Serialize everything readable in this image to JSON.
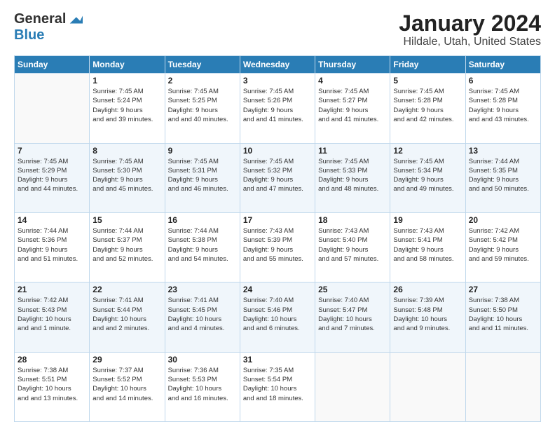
{
  "logo": {
    "general": "General",
    "blue": "Blue"
  },
  "title": "January 2024",
  "location": "Hildale, Utah, United States",
  "days_of_week": [
    "Sunday",
    "Monday",
    "Tuesday",
    "Wednesday",
    "Thursday",
    "Friday",
    "Saturday"
  ],
  "weeks": [
    [
      {
        "day": "",
        "sunrise": "",
        "sunset": "",
        "daylight": ""
      },
      {
        "day": "1",
        "sunrise": "Sunrise: 7:45 AM",
        "sunset": "Sunset: 5:24 PM",
        "daylight": "Daylight: 9 hours and 39 minutes."
      },
      {
        "day": "2",
        "sunrise": "Sunrise: 7:45 AM",
        "sunset": "Sunset: 5:25 PM",
        "daylight": "Daylight: 9 hours and 40 minutes."
      },
      {
        "day": "3",
        "sunrise": "Sunrise: 7:45 AM",
        "sunset": "Sunset: 5:26 PM",
        "daylight": "Daylight: 9 hours and 41 minutes."
      },
      {
        "day": "4",
        "sunrise": "Sunrise: 7:45 AM",
        "sunset": "Sunset: 5:27 PM",
        "daylight": "Daylight: 9 hours and 41 minutes."
      },
      {
        "day": "5",
        "sunrise": "Sunrise: 7:45 AM",
        "sunset": "Sunset: 5:28 PM",
        "daylight": "Daylight: 9 hours and 42 minutes."
      },
      {
        "day": "6",
        "sunrise": "Sunrise: 7:45 AM",
        "sunset": "Sunset: 5:28 PM",
        "daylight": "Daylight: 9 hours and 43 minutes."
      }
    ],
    [
      {
        "day": "7",
        "sunrise": "Sunrise: 7:45 AM",
        "sunset": "Sunset: 5:29 PM",
        "daylight": "Daylight: 9 hours and 44 minutes."
      },
      {
        "day": "8",
        "sunrise": "Sunrise: 7:45 AM",
        "sunset": "Sunset: 5:30 PM",
        "daylight": "Daylight: 9 hours and 45 minutes."
      },
      {
        "day": "9",
        "sunrise": "Sunrise: 7:45 AM",
        "sunset": "Sunset: 5:31 PM",
        "daylight": "Daylight: 9 hours and 46 minutes."
      },
      {
        "day": "10",
        "sunrise": "Sunrise: 7:45 AM",
        "sunset": "Sunset: 5:32 PM",
        "daylight": "Daylight: 9 hours and 47 minutes."
      },
      {
        "day": "11",
        "sunrise": "Sunrise: 7:45 AM",
        "sunset": "Sunset: 5:33 PM",
        "daylight": "Daylight: 9 hours and 48 minutes."
      },
      {
        "day": "12",
        "sunrise": "Sunrise: 7:45 AM",
        "sunset": "Sunset: 5:34 PM",
        "daylight": "Daylight: 9 hours and 49 minutes."
      },
      {
        "day": "13",
        "sunrise": "Sunrise: 7:44 AM",
        "sunset": "Sunset: 5:35 PM",
        "daylight": "Daylight: 9 hours and 50 minutes."
      }
    ],
    [
      {
        "day": "14",
        "sunrise": "Sunrise: 7:44 AM",
        "sunset": "Sunset: 5:36 PM",
        "daylight": "Daylight: 9 hours and 51 minutes."
      },
      {
        "day": "15",
        "sunrise": "Sunrise: 7:44 AM",
        "sunset": "Sunset: 5:37 PM",
        "daylight": "Daylight: 9 hours and 52 minutes."
      },
      {
        "day": "16",
        "sunrise": "Sunrise: 7:44 AM",
        "sunset": "Sunset: 5:38 PM",
        "daylight": "Daylight: 9 hours and 54 minutes."
      },
      {
        "day": "17",
        "sunrise": "Sunrise: 7:43 AM",
        "sunset": "Sunset: 5:39 PM",
        "daylight": "Daylight: 9 hours and 55 minutes."
      },
      {
        "day": "18",
        "sunrise": "Sunrise: 7:43 AM",
        "sunset": "Sunset: 5:40 PM",
        "daylight": "Daylight: 9 hours and 57 minutes."
      },
      {
        "day": "19",
        "sunrise": "Sunrise: 7:43 AM",
        "sunset": "Sunset: 5:41 PM",
        "daylight": "Daylight: 9 hours and 58 minutes."
      },
      {
        "day": "20",
        "sunrise": "Sunrise: 7:42 AM",
        "sunset": "Sunset: 5:42 PM",
        "daylight": "Daylight: 9 hours and 59 minutes."
      }
    ],
    [
      {
        "day": "21",
        "sunrise": "Sunrise: 7:42 AM",
        "sunset": "Sunset: 5:43 PM",
        "daylight": "Daylight: 10 hours and 1 minute."
      },
      {
        "day": "22",
        "sunrise": "Sunrise: 7:41 AM",
        "sunset": "Sunset: 5:44 PM",
        "daylight": "Daylight: 10 hours and 2 minutes."
      },
      {
        "day": "23",
        "sunrise": "Sunrise: 7:41 AM",
        "sunset": "Sunset: 5:45 PM",
        "daylight": "Daylight: 10 hours and 4 minutes."
      },
      {
        "day": "24",
        "sunrise": "Sunrise: 7:40 AM",
        "sunset": "Sunset: 5:46 PM",
        "daylight": "Daylight: 10 hours and 6 minutes."
      },
      {
        "day": "25",
        "sunrise": "Sunrise: 7:40 AM",
        "sunset": "Sunset: 5:47 PM",
        "daylight": "Daylight: 10 hours and 7 minutes."
      },
      {
        "day": "26",
        "sunrise": "Sunrise: 7:39 AM",
        "sunset": "Sunset: 5:48 PM",
        "daylight": "Daylight: 10 hours and 9 minutes."
      },
      {
        "day": "27",
        "sunrise": "Sunrise: 7:38 AM",
        "sunset": "Sunset: 5:50 PM",
        "daylight": "Daylight: 10 hours and 11 minutes."
      }
    ],
    [
      {
        "day": "28",
        "sunrise": "Sunrise: 7:38 AM",
        "sunset": "Sunset: 5:51 PM",
        "daylight": "Daylight: 10 hours and 13 minutes."
      },
      {
        "day": "29",
        "sunrise": "Sunrise: 7:37 AM",
        "sunset": "Sunset: 5:52 PM",
        "daylight": "Daylight: 10 hours and 14 minutes."
      },
      {
        "day": "30",
        "sunrise": "Sunrise: 7:36 AM",
        "sunset": "Sunset: 5:53 PM",
        "daylight": "Daylight: 10 hours and 16 minutes."
      },
      {
        "day": "31",
        "sunrise": "Sunrise: 7:35 AM",
        "sunset": "Sunset: 5:54 PM",
        "daylight": "Daylight: 10 hours and 18 minutes."
      },
      {
        "day": "",
        "sunrise": "",
        "sunset": "",
        "daylight": ""
      },
      {
        "day": "",
        "sunrise": "",
        "sunset": "",
        "daylight": ""
      },
      {
        "day": "",
        "sunrise": "",
        "sunset": "",
        "daylight": ""
      }
    ]
  ]
}
